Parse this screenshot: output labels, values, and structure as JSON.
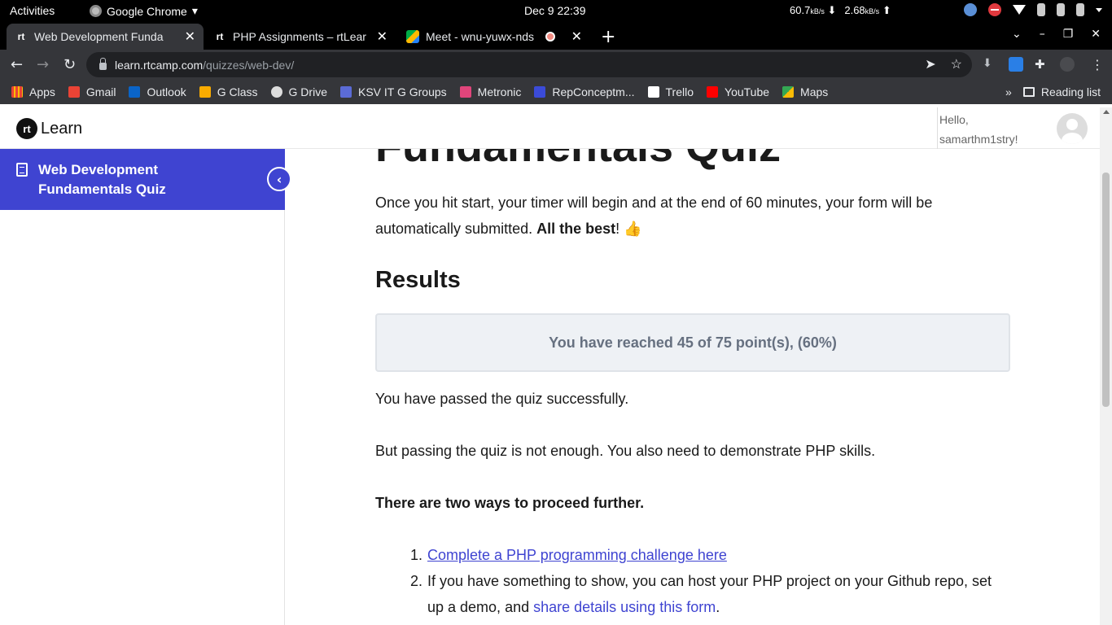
{
  "os_bar": {
    "activities": "Activities",
    "app_name": "Google Chrome",
    "clock": "Dec 9  22:39",
    "down_speed": "60.7",
    "up_speed": "2.68",
    "speed_unit": "kB/s"
  },
  "tabs": [
    {
      "title": "Web Development Funda",
      "favicon": "rt"
    },
    {
      "title": "PHP Assignments – rtLear",
      "favicon": "rt"
    },
    {
      "title": "Meet - wnu-yuwx-nds",
      "favicon": "meet-icon"
    }
  ],
  "address": {
    "host": "learn.rtcamp.com",
    "path": "/quizzes/web-dev/"
  },
  "bookmarks": [
    {
      "label": "Apps",
      "color": "#4285f4"
    },
    {
      "label": "Gmail",
      "color": "#ea4335"
    },
    {
      "label": "Outlook",
      "color": "#0a64c8"
    },
    {
      "label": "G Class",
      "color": "#f9ab00"
    },
    {
      "label": "G Drive",
      "color": "#dddddd"
    },
    {
      "label": "KSV IT G Groups",
      "color": "#5b6bd6"
    },
    {
      "label": "Metronic",
      "color": "#e0457b"
    },
    {
      "label": "RepConceptm...",
      "color": "#3b4bd8"
    },
    {
      "label": "Trello",
      "color": "#ffffff"
    },
    {
      "label": "YouTube",
      "color": "#ff0000"
    },
    {
      "label": "Maps",
      "color": "#34a853"
    }
  ],
  "bookmarks_overflow": "»",
  "reading_list": "Reading list",
  "site": {
    "logo_mark": "rt",
    "logo_text": "Learn",
    "greeting": "Hello,",
    "username": "samarthm1stry!"
  },
  "sidebar": {
    "active_item": "Web Development Fundamentals Quiz",
    "collapse_glyph": "‹"
  },
  "content": {
    "cut_title": "Fundamentals Quiz",
    "intro_text": "Once you hit start, your timer will begin and at the end of 60 minutes, your form will be automatically submitted. ",
    "intro_bold": "All the best",
    "intro_end": "! 👍",
    "results_heading": "Results",
    "score_text": "You have reached 45 of 75 point(s), (60%)",
    "passed_text": "You have passed the quiz successfully.",
    "not_enough_text": "But passing the quiz is not enough. You also need to demonstrate PHP skills.",
    "ways_text": "There are two ways to proceed further.",
    "step1_num": "1.",
    "step1_link": "Complete a PHP programming challenge here",
    "step2_num": "2.",
    "step2_text": "If you have something to show, you can host your PHP project on your Github repo, set up a demo, and ",
    "step2_link": "share details using this form",
    "step2_end": "."
  },
  "colors": {
    "accent": "#3f44d1",
    "score_bg": "#eef1f5"
  }
}
